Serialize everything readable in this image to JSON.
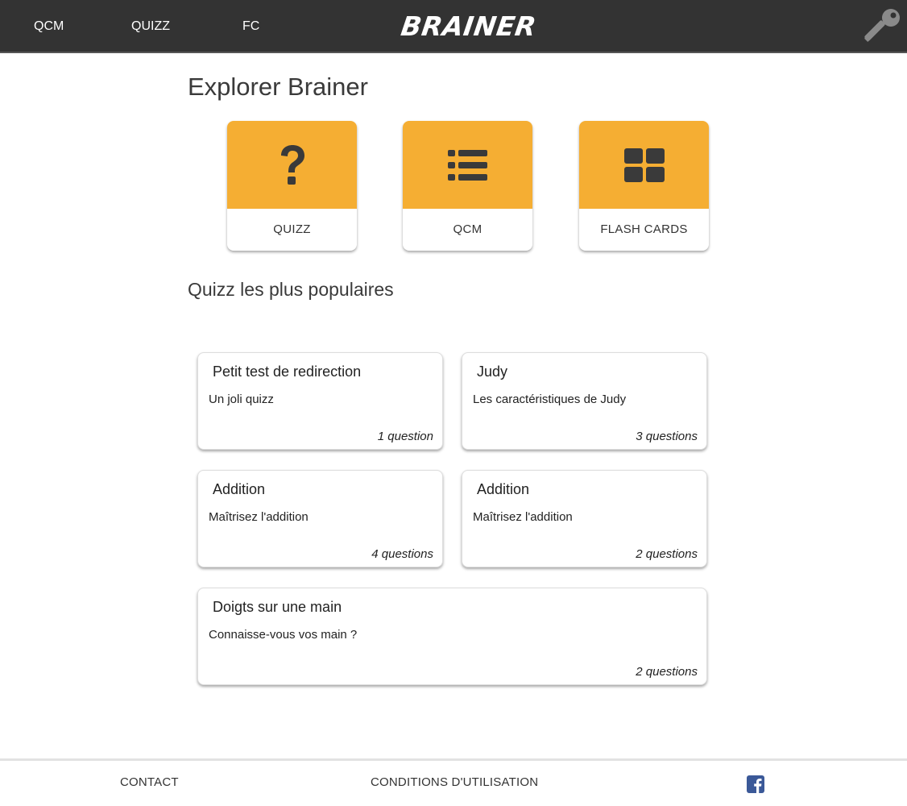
{
  "nav": {
    "links": [
      "QCM",
      "QUIZZ",
      "FC"
    ],
    "logo": "BRAINER",
    "login_icon": "key-icon"
  },
  "page_title": "Explorer Brainer",
  "categories": [
    {
      "label": "QUIZZ",
      "icon": "question-mark-icon"
    },
    {
      "label": "QCM",
      "icon": "list-icon"
    },
    {
      "label": "FLASH CARDS",
      "icon": "grid-icon"
    }
  ],
  "popular_title": "Quizz les plus populaires",
  "quizzes": [
    {
      "title": "Petit test de redirection",
      "description": "Un joli quizz",
      "count": "1 question"
    },
    {
      "title": "Judy",
      "description": "Les caractéristiques de Judy",
      "count": "3 questions"
    },
    {
      "title": "Addition",
      "description": "Maîtrisez l'addition",
      "count": "4 questions"
    },
    {
      "title": "Addition",
      "description": "Maîtrisez l'addition",
      "count": "2 questions"
    },
    {
      "title": "Doigts sur une main",
      "description": "Connaisse-vous vos main ?",
      "count": "2 questions"
    }
  ],
  "footer": {
    "contact": "CONTACT",
    "terms": "CONDITIONS D'UTILISATION",
    "social_icon": "facebook-icon"
  },
  "colors": {
    "topbar": "#333333",
    "accent": "#f5ae33",
    "facebook": "#3b5998"
  }
}
